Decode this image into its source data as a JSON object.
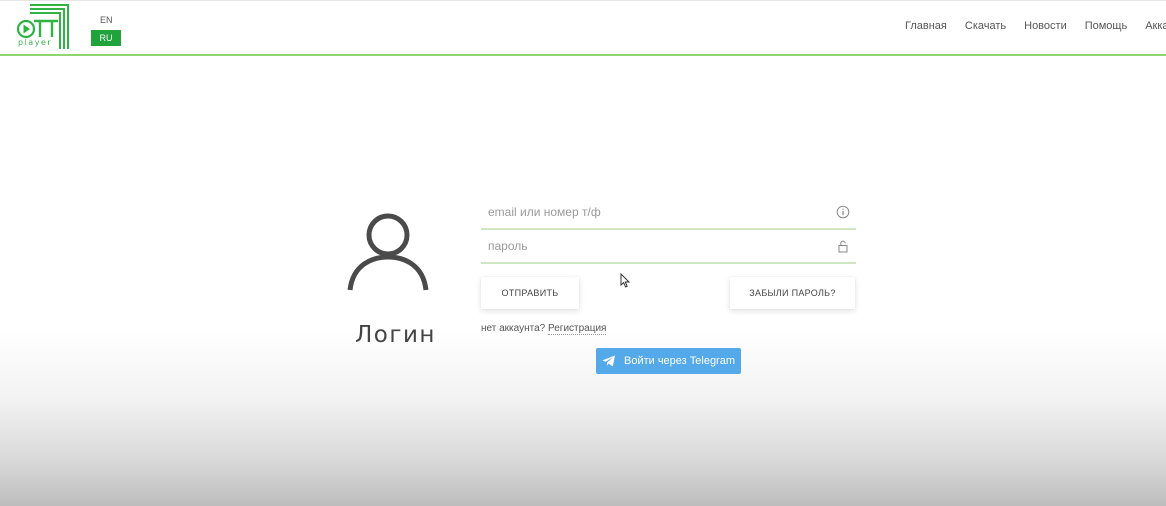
{
  "header": {
    "logo_text": "OTT",
    "logo_subtext": "player",
    "languages": {
      "en": "EN",
      "ru": "RU",
      "active": "RU"
    },
    "nav": [
      "Главная",
      "Скачать",
      "Новости",
      "Помощь",
      "Аккаунт"
    ]
  },
  "login": {
    "title": "Логин",
    "email_placeholder": "email или номер т/ф",
    "password_placeholder": "пароль",
    "submit_label": "ОТПРАВИТЬ",
    "forgot_label": "ЗАБЫЛИ ПАРОЛЬ?",
    "no_account_text": "нет аккаунта?",
    "register_label": "Регистрация",
    "telegram_label": "Войти через Telegram"
  },
  "colors": {
    "accent_green": "#1fa33a",
    "header_border": "#8fd46f",
    "telegram_blue": "#54a9eb"
  }
}
